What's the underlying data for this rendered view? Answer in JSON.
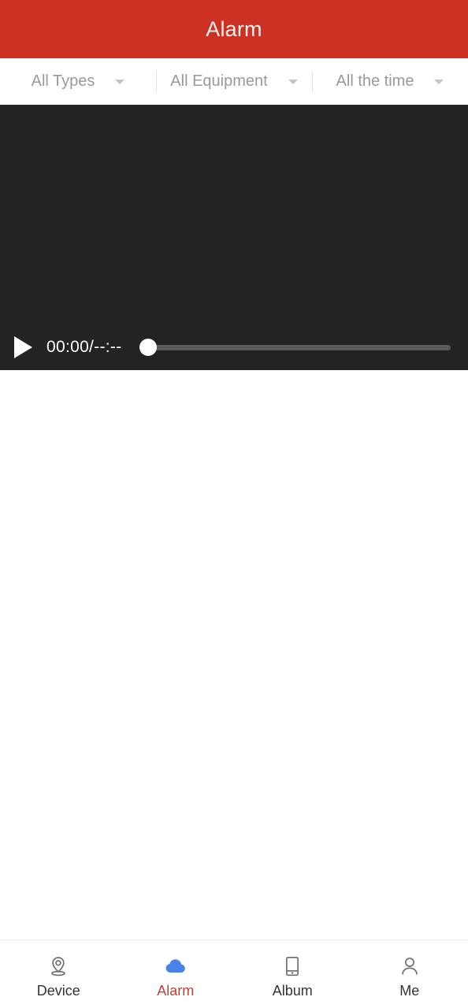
{
  "header": {
    "title": "Alarm",
    "background_color": "#cc3124",
    "text_color": "#f7f2ee"
  },
  "filters": [
    {
      "label": "All Types",
      "icon": "chevron-down-icon"
    },
    {
      "label": "All Equipment",
      "icon": "chevron-down-icon"
    },
    {
      "label": "All the time",
      "icon": "chevron-down-icon"
    }
  ],
  "video_player": {
    "background_color": "#232323",
    "play_icon": "play-icon",
    "time_display": "00:00/--:--",
    "current_time": "00:00",
    "total_time": "--:--",
    "progress_percent": 0
  },
  "bottom_nav": {
    "active_color": "#bf4038",
    "items": [
      {
        "label": "Device",
        "icon": "location-pin-icon",
        "active": false
      },
      {
        "label": "Alarm",
        "icon": "cloud-icon",
        "active": true
      },
      {
        "label": "Album",
        "icon": "phone-icon",
        "active": false
      },
      {
        "label": "Me",
        "icon": "user-icon",
        "active": false
      }
    ]
  }
}
